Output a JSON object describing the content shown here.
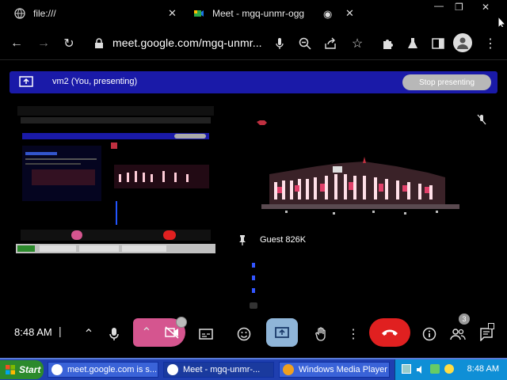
{
  "tabs": [
    {
      "title": "file:///"
    },
    {
      "title": "Meet - mgq-unmr-ogg"
    }
  ],
  "url": "meet.google.com/mgq-unmr...",
  "banner": {
    "label": "vm2 (You, presenting)",
    "stop_label": "Stop presenting"
  },
  "participant": {
    "name": "Guest 826K"
  },
  "controls": {
    "time": "8:48 AM",
    "participants_count": "3"
  },
  "taskbar": {
    "start_label": "Start",
    "tasks": [
      {
        "label": "meet.google.com is s..."
      },
      {
        "label": "Meet - mgq-unmr-..."
      },
      {
        "label": "Windows Media Player"
      }
    ],
    "clock": "8:48 AM"
  },
  "colors": {
    "banner": "#1a1aa8",
    "stop_button": "#b8b8b8",
    "end_call": "#e02020",
    "active_button": "#d5558f",
    "taskbar": "#1f3fb0"
  }
}
